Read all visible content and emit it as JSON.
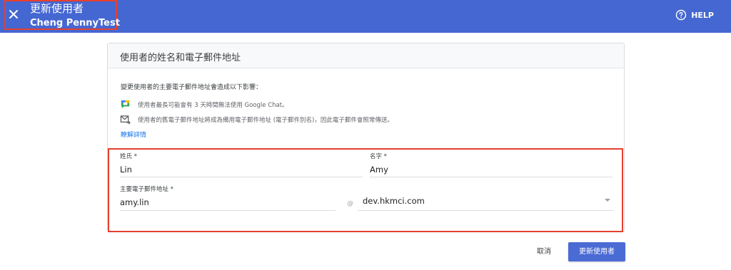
{
  "header": {
    "title": "更新使用者",
    "user_name": "Cheng PennyTest",
    "help_label": "HELP",
    "close_icon": "close-icon",
    "help_icon": "help-circle-icon",
    "bar_color": "#4567d1"
  },
  "card": {
    "title": "使用者的姓名和電子郵件地址",
    "intro": "變更使用者的主要電子郵件地址會造成以下影響：",
    "notes": [
      {
        "icon": "google-chat-icon",
        "text": "使用者最長可能會有 3 天時間無法使用 Google Chat。"
      },
      {
        "icon": "mail-forward-icon",
        "text": "使用者的舊電子郵件地址將成為備用電子郵件地址 (電子郵件別名)，因此電子郵件會照常傳送。"
      }
    ],
    "learn_more": "瞭解詳情"
  },
  "form": {
    "last_name": {
      "label": "姓氏 *",
      "value": "Lin"
    },
    "first_name": {
      "label": "名字 *",
      "value": "Amy"
    },
    "email": {
      "label": "主要電子郵件地址 *",
      "value": "amy.lin"
    },
    "at_symbol": "@",
    "domain": {
      "value": "dev.hkmci.com"
    }
  },
  "footer": {
    "cancel_label": "取消",
    "submit_label": "更新使用者",
    "submit_color": "#4a6ad4"
  },
  "highlight_color": "#e5402f"
}
